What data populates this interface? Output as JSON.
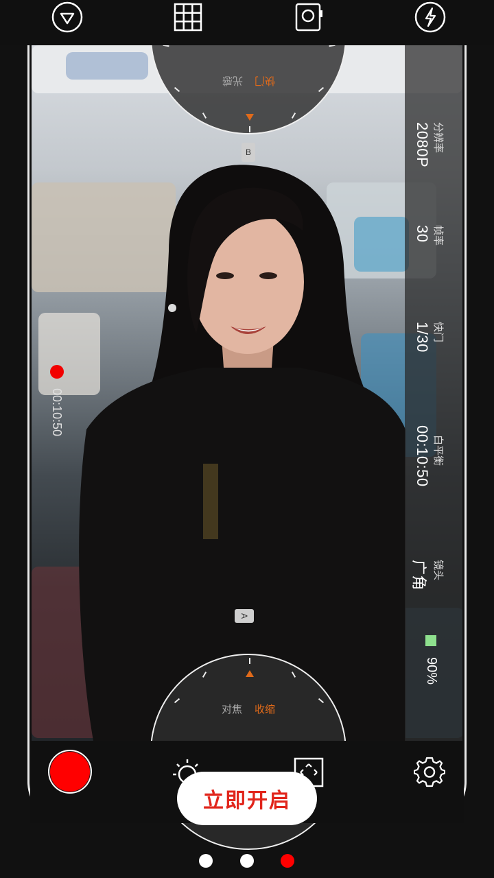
{
  "top_bar": {
    "icons": [
      "play-triangle-icon",
      "grid-icon",
      "camera-switch-icon",
      "flash-icon"
    ]
  },
  "dial_top": {
    "active": "快门",
    "inactive": "光感",
    "marker": "B"
  },
  "dial_bottom": {
    "inactive": "对焦",
    "active": "收缩",
    "marker": "A"
  },
  "settings_panel": {
    "resolution_label": "分辨率",
    "resolution_value": "2080P",
    "framerate_label": "帧率",
    "framerate_value": "30",
    "shutter_label": "快门",
    "shutter_value": "1/30",
    "whitebalance_label": "白平衡",
    "whitebalance_value": "00:10:50",
    "lens_label": "镜头",
    "lens_value": "广角"
  },
  "recording": {
    "time": "00:10:50"
  },
  "battery": {
    "level": "90%",
    "color": "#8ee08e"
  },
  "bottom_bar": {
    "icons": [
      "record-button",
      "exposure-icon",
      "focus-frame-icon",
      "settings-gear-icon"
    ]
  },
  "cta": {
    "label": "立即开启"
  },
  "pagination": {
    "count": 3,
    "active_index": 2,
    "active_color": "#ff0000",
    "inactive_color": "#ffffff"
  },
  "colors": {
    "accent": "#e06a1a",
    "record": "#ff0000",
    "cta_text": "#e1251b"
  }
}
